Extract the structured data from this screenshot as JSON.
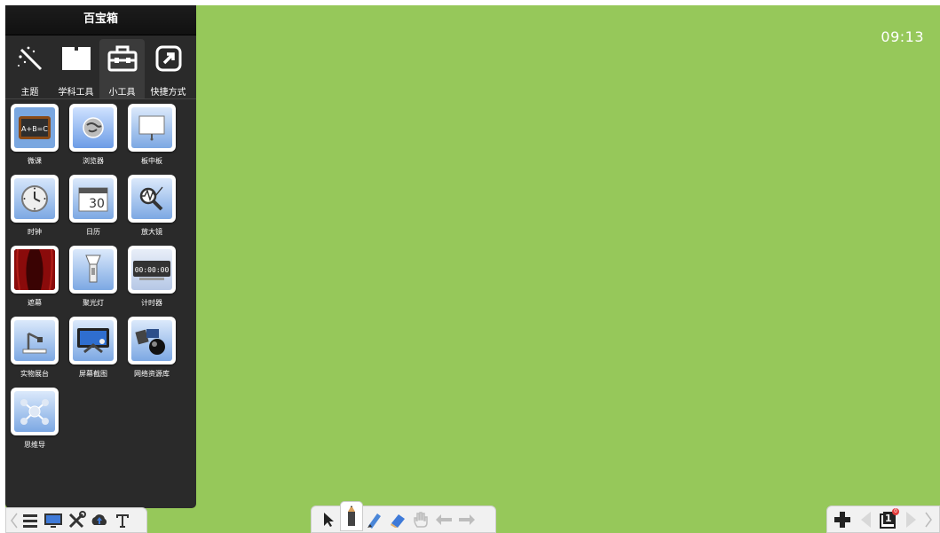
{
  "panel": {
    "title": "百宝箱",
    "tabs": [
      {
        "label": "主题",
        "icon": "magic-wand-icon"
      },
      {
        "label": "学科工具",
        "icon": "book-icon"
      },
      {
        "label": "小工具",
        "icon": "toolbox-icon",
        "active": true
      },
      {
        "label": "快捷方式",
        "icon": "shortcut-arrow-icon"
      }
    ],
    "tools": [
      {
        "label": "微课",
        "icon": "chalkboard-icon"
      },
      {
        "label": "浏览器",
        "icon": "globe-icon"
      },
      {
        "label": "板中板",
        "icon": "whiteboard-icon"
      },
      {
        "label": "时钟",
        "icon": "clock-icon"
      },
      {
        "label": "日历",
        "icon": "calendar-icon",
        "text": "30"
      },
      {
        "label": "放大镜",
        "icon": "magnifier-icon"
      },
      {
        "label": "遮幕",
        "icon": "curtain-icon"
      },
      {
        "label": "聚光灯",
        "icon": "spotlight-icon"
      },
      {
        "label": "计时器",
        "icon": "timer-icon",
        "text": "00:00:00"
      },
      {
        "label": "实物展台",
        "icon": "document-camera-icon"
      },
      {
        "label": "屏幕截图",
        "icon": "screenshot-icon"
      },
      {
        "label": "网络资源库",
        "icon": "network-resources-icon"
      },
      {
        "label": "思维导",
        "icon": "mind-map-icon"
      }
    ]
  },
  "clock": "09:13",
  "bottom_left": [
    "menu-icon",
    "monitor-icon",
    "tools-icon",
    "cloud-upload-icon",
    "text-t-icon"
  ],
  "bottom_middle": [
    "pointer-icon",
    "pen-icon",
    "highlighter-icon",
    "eraser-icon",
    "hand-icon",
    "undo-icon",
    "redo-icon"
  ],
  "bottom_right": {
    "page_number": "1",
    "badge": "0"
  },
  "colors": {
    "canvas": "#96c85a",
    "panel": "#2a2a2a"
  }
}
